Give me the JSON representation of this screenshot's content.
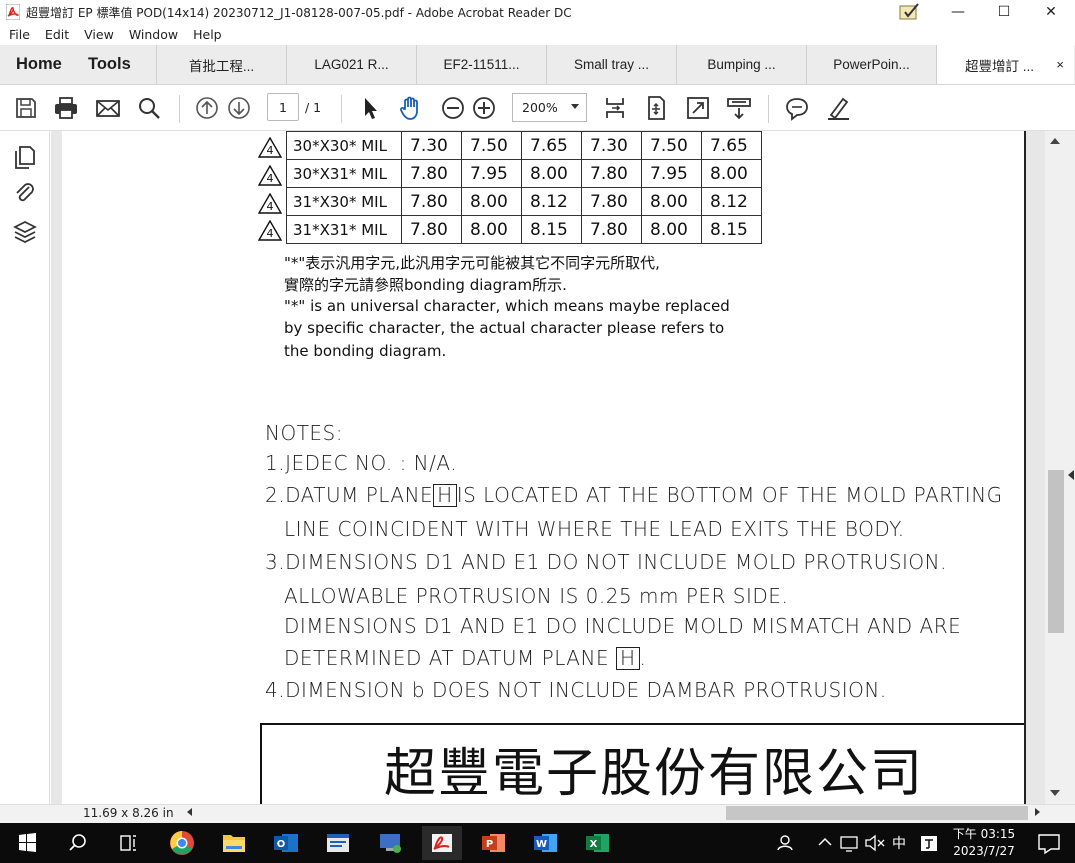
{
  "window": {
    "title": "超豐增訂 EP 標準值 POD(14x14) 20230712_J1-08128-007-05.pdf - Adobe Acrobat Reader DC",
    "controls": {
      "minimize": "—",
      "maximize": "☐",
      "close": "✕"
    }
  },
  "menu": [
    "File",
    "Edit",
    "View",
    "Window",
    "Help"
  ],
  "tabs": {
    "home": "Home",
    "tools": "Tools",
    "docs": [
      "首批工程...",
      "LAG021 R...",
      "EF2-11511...",
      "Small tray ...",
      "Bumping ...",
      "PowerPoin..."
    ],
    "active_doc": "超豐增訂 ...",
    "close": "×"
  },
  "toolbar": {
    "page_current": "1",
    "page_total": "/ 1",
    "zoom": "200%"
  },
  "document": {
    "table_rows": [
      {
        "label": "30*X30* MIL",
        "values": [
          "7.30",
          "7.50",
          "7.65",
          "7.30",
          "7.50",
          "7.65"
        ]
      },
      {
        "label": "30*X31* MIL",
        "values": [
          "7.80",
          "7.95",
          "8.00",
          "7.80",
          "7.95",
          "8.00"
        ]
      },
      {
        "label": "31*X30* MIL",
        "values": [
          "7.80",
          "8.00",
          "8.12",
          "7.80",
          "8.00",
          "8.12"
        ]
      },
      {
        "label": "31*X31* MIL",
        "values": [
          "7.80",
          "8.00",
          "8.15",
          "7.80",
          "8.00",
          "8.15"
        ]
      }
    ],
    "triangle_mark": "4",
    "note_cn_1": "\"*\"表示汎用字元,此汎用字元可能被其它不同字元所取代,",
    "note_cn_2": "實際的字元請參照bonding diagram所示.",
    "note_en_1": "\"*\" is an universal character, which means maybe replaced",
    "note_en_2": "by specific character, the actual character please refers to",
    "note_en_3": "the bonding diagram.",
    "notes_title": "NOTES:",
    "note1": "1.JEDEC NO. : N/A.",
    "note2a_pre": "2.DATUM PLANE",
    "note2a_box": "H",
    "note2a_post": "IS LOCATED AT THE BOTTOM OF THE MOLD PARTING",
    "note2b": "LINE COINCIDENT WITH WHERE THE LEAD EXITS THE BODY.",
    "note3a": "3.DIMENSIONS D1 AND E1 DO NOT INCLUDE MOLD PROTRUSION.",
    "note3b": "ALLOWABLE PROTRUSION IS 0.25 mm PER SIDE.",
    "note3c": "DIMENSIONS D1 AND E1 DO INCLUDE MOLD MISMATCH AND ARE",
    "note3d_pre": "DETERMINED AT DATUM PLANE",
    "note3d_box": "H",
    "note3d_post": ".",
    "note4": "4.DIMENSION b DOES NOT INCLUDE DAMBAR PROTRUSION.",
    "company": "超豐電子股份有限公司"
  },
  "status": {
    "page_size": "11.69 x 8.26 in"
  },
  "taskbar": {
    "ime": "中",
    "clock_time": "下午 03:15",
    "clock_date": "2023/7/27"
  },
  "colors": {
    "acrobat_red": "#d7261e",
    "taskbar": "#0b0b0b",
    "tab_bg": "#ececec"
  }
}
